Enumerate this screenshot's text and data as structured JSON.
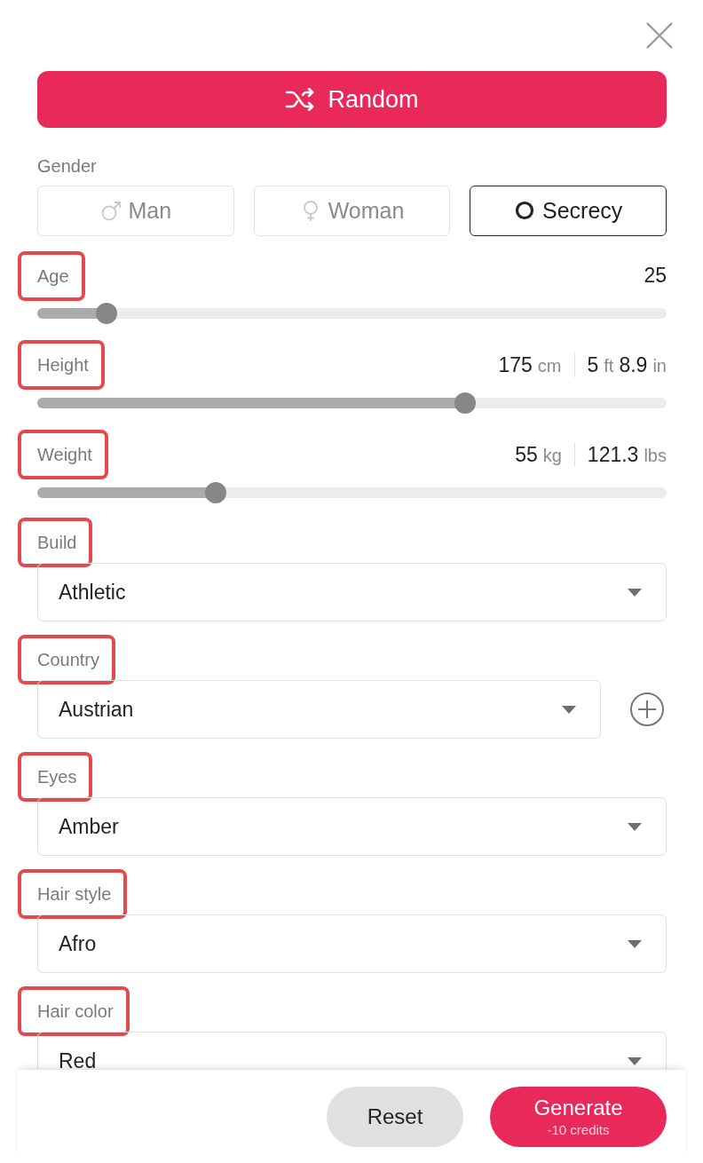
{
  "random_button": {
    "label": "Random"
  },
  "gender": {
    "label": "Gender",
    "options": [
      {
        "label": "Man",
        "selected": false
      },
      {
        "label": "Woman",
        "selected": false
      },
      {
        "label": "Secrecy",
        "selected": true
      }
    ]
  },
  "fields": [
    {
      "kind": "slider",
      "label": "Age",
      "highlighted": true,
      "level": 0.11,
      "readings": [
        [
          {
            "text": "25",
            "kind": "number"
          }
        ]
      ]
    },
    {
      "kind": "slider",
      "label": "Height",
      "highlighted": true,
      "level": 0.68,
      "readings": [
        [
          {
            "text": "175",
            "kind": "number"
          },
          {
            "text": "cm",
            "kind": "unit"
          }
        ],
        [
          {
            "text": "5",
            "kind": "number"
          },
          {
            "text": "ft",
            "kind": "unit"
          },
          {
            "text": "8.9",
            "kind": "number"
          },
          {
            "text": "in",
            "kind": "unit"
          }
        ]
      ]
    },
    {
      "kind": "slider",
      "label": "Weight",
      "highlighted": true,
      "level": 0.283,
      "readings": [
        [
          {
            "text": "55",
            "kind": "number"
          },
          {
            "text": "kg",
            "kind": "unit"
          }
        ],
        [
          {
            "text": "121.3",
            "kind": "number"
          },
          {
            "text": "lbs",
            "kind": "unit"
          }
        ]
      ]
    },
    {
      "kind": "select",
      "label": "Build",
      "highlighted": true,
      "value": "Athletic"
    },
    {
      "kind": "addselect",
      "label": "Country",
      "highlighted": true,
      "value": "Austrian"
    },
    {
      "kind": "select",
      "label": "Eyes",
      "highlighted": true,
      "value": "Amber"
    },
    {
      "kind": "select",
      "label": "Hair style",
      "highlighted": true,
      "value": "Afro"
    },
    {
      "kind": "select",
      "label": "Hair color",
      "highlighted": true,
      "value": "Red"
    }
  ],
  "footer": {
    "reset": "Reset",
    "generate": {
      "label": "Generate",
      "cost": "-10 credits"
    }
  }
}
